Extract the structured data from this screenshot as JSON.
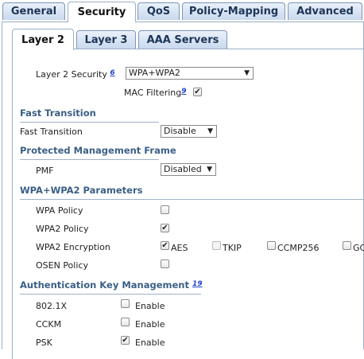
{
  "top_tabs": [
    "General",
    "Security",
    "QoS",
    "Policy-Mapping",
    "Advanced"
  ],
  "sub_tabs": [
    "Layer 2",
    "Layer 3",
    "AAA Servers"
  ],
  "layer2_security": {
    "label": "Layer 2 Security",
    "footnote": "6",
    "value": "WPA+WPA2"
  },
  "mac_filtering": {
    "label": "MAC Filtering",
    "footnote": "9",
    "checked": true
  },
  "fast_transition": {
    "section": "Fast Transition",
    "label": "Fast Transition",
    "value": "Disable"
  },
  "pmf": {
    "section": "Protected Management Frame",
    "label": "PMF",
    "value": "Disabled"
  },
  "wpa_params": {
    "section": "WPA+WPA2 Parameters",
    "wpa_policy": {
      "label": "WPA Policy",
      "checked": false
    },
    "wpa2_policy": {
      "label": "WPA2 Policy",
      "checked": true
    },
    "wpa2_encryption": {
      "label": "WPA2 Encryption",
      "aes": "AES",
      "aes_checked": true,
      "tkip": "TKIP",
      "ccmp256": "CCMP256",
      "gcmp": "GC"
    },
    "osen_policy": {
      "label": "OSEN Policy",
      "checked": false
    }
  },
  "akm": {
    "section": "Authentication Key Management",
    "footnote": "19",
    "rows": [
      {
        "label": "802.1X",
        "option": "Enable",
        "checked": false
      },
      {
        "label": "CCKM",
        "option": "Enable",
        "checked": false
      },
      {
        "label": "PSK",
        "option": "Enable",
        "checked": true
      }
    ]
  },
  "check_glyph": "✔"
}
